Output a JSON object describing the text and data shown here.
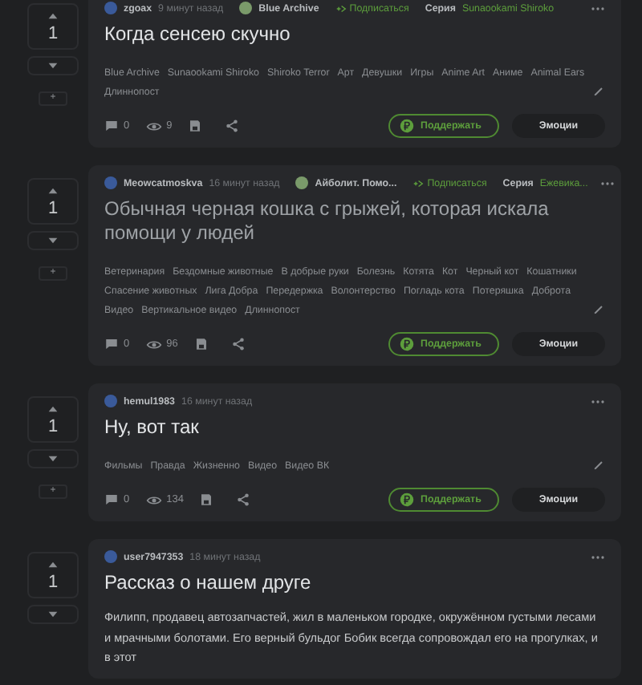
{
  "posts": [
    {
      "rating": "1",
      "extra_glyph": "+",
      "author": "zgoax",
      "time": "9 минут назад",
      "community": "Blue Archive",
      "subscribe": "Подписаться",
      "series_label": "Серия",
      "series": "Sunaookami Shiroko",
      "title": "Когда сенсею скучно",
      "viewed": false,
      "tags": [
        "Blue Archive",
        "Sunaookami Shiroko",
        "Shiroko Terror",
        "Арт",
        "Девушки",
        "Игры",
        "Anime Art",
        "Аниме",
        "Animal Ears",
        "Длиннопост"
      ],
      "comments": "0",
      "views": "9",
      "support": "Поддержать",
      "emotions": "Эмоции"
    },
    {
      "rating": "1",
      "extra_glyph": "+",
      "author": "Meowcatmoskva",
      "time": "16 минут назад",
      "community": "Айболит. Помо...",
      "subscribe": "Подписаться",
      "series_label": "Серия",
      "series": "Ежевика...",
      "title": "Обычная черная кошка с грыжей, которая искала помощи у людей",
      "viewed": true,
      "tags": [
        "Ветеринария",
        "Бездомные животные",
        "В добрые руки",
        "Болезнь",
        "Котята",
        "Кот",
        "Черный кот",
        "Кошатники",
        "Спасение животных",
        "Лига Добра",
        "Передержка",
        "Волонтерство",
        "Погладь кота",
        "Потеряшка",
        "Доброта",
        "Видео",
        "Вертикальное видео",
        "Длиннопост"
      ],
      "comments": "0",
      "views": "96",
      "support": "Поддержать",
      "emotions": "Эмоции"
    },
    {
      "rating": "1",
      "extra_glyph": "+",
      "author": "hemul1983",
      "time": "16 минут назад",
      "title": "Ну, вот так",
      "viewed": false,
      "tags": [
        "Фильмы",
        "Правда",
        "Жизненно",
        "Видео",
        "Видео ВК"
      ],
      "comments": "0",
      "views": "134",
      "support": "Поддержать",
      "emotions": "Эмоции"
    },
    {
      "rating": "1",
      "author": "user7947353",
      "time": "18 минут назад",
      "title": "Рассказ о нашем друге",
      "viewed": false,
      "body": "Филипп, продавец автозапчастей, жил в маленьком городке, окружённом густыми лесами и мрачными болотами. Его верный бульдог Бобик всегда сопровождал его на прогулках, и в этот"
    }
  ]
}
